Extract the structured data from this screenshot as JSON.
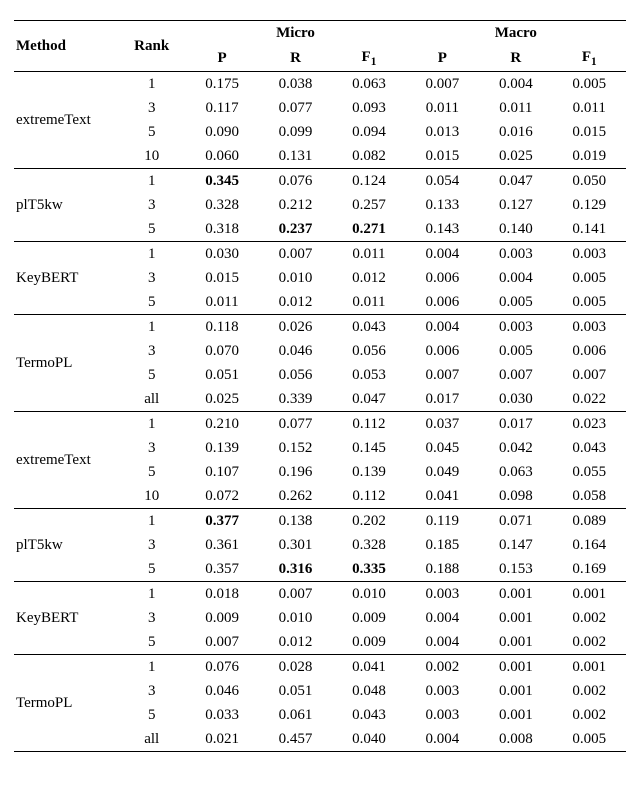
{
  "headers": {
    "method": "Method",
    "rank": "Rank",
    "micro": "Micro",
    "macro": "Macro",
    "P": "P",
    "R": "R",
    "F1_html": "F<sub>1</sub>"
  },
  "chart_data": {
    "type": "table",
    "title": "",
    "column_groups": [
      "Micro",
      "Macro"
    ],
    "columns": [
      "Method",
      "Rank",
      "Micro.P",
      "Micro.R",
      "Micro.F1",
      "Macro.P",
      "Macro.R",
      "Macro.F1"
    ],
    "bold_cells": [
      {
        "group_index": 1,
        "row_index": 0,
        "col": "micro_P"
      },
      {
        "group_index": 1,
        "row_index": 2,
        "col": "micro_R"
      },
      {
        "group_index": 1,
        "row_index": 2,
        "col": "micro_F1"
      },
      {
        "group_index": 5,
        "row_index": 0,
        "col": "micro_P"
      },
      {
        "group_index": 5,
        "row_index": 2,
        "col": "micro_R"
      },
      {
        "group_index": 5,
        "row_index": 2,
        "col": "micro_F1"
      }
    ],
    "groups": [
      {
        "method": "extremeText",
        "rows": [
          {
            "rank": "1",
            "micro_P": "0.175",
            "micro_R": "0.038",
            "micro_F1": "0.063",
            "macro_P": "0.007",
            "macro_R": "0.004",
            "macro_F1": "0.005"
          },
          {
            "rank": "3",
            "micro_P": "0.117",
            "micro_R": "0.077",
            "micro_F1": "0.093",
            "macro_P": "0.011",
            "macro_R": "0.011",
            "macro_F1": "0.011"
          },
          {
            "rank": "5",
            "micro_P": "0.090",
            "micro_R": "0.099",
            "micro_F1": "0.094",
            "macro_P": "0.013",
            "macro_R": "0.016",
            "macro_F1": "0.015"
          },
          {
            "rank": "10",
            "micro_P": "0.060",
            "micro_R": "0.131",
            "micro_F1": "0.082",
            "macro_P": "0.015",
            "macro_R": "0.025",
            "macro_F1": "0.019"
          }
        ]
      },
      {
        "method": "plT5kw",
        "rows": [
          {
            "rank": "1",
            "micro_P": "0.345",
            "micro_R": "0.076",
            "micro_F1": "0.124",
            "macro_P": "0.054",
            "macro_R": "0.047",
            "macro_F1": "0.050"
          },
          {
            "rank": "3",
            "micro_P": "0.328",
            "micro_R": "0.212",
            "micro_F1": "0.257",
            "macro_P": "0.133",
            "macro_R": "0.127",
            "macro_F1": "0.129"
          },
          {
            "rank": "5",
            "micro_P": "0.318",
            "micro_R": "0.237",
            "micro_F1": "0.271",
            "macro_P": "0.143",
            "macro_R": "0.140",
            "macro_F1": "0.141"
          }
        ]
      },
      {
        "method": "KeyBERT",
        "rows": [
          {
            "rank": "1",
            "micro_P": "0.030",
            "micro_R": "0.007",
            "micro_F1": "0.011",
            "macro_P": "0.004",
            "macro_R": "0.003",
            "macro_F1": "0.003"
          },
          {
            "rank": "3",
            "micro_P": "0.015",
            "micro_R": "0.010",
            "micro_F1": "0.012",
            "macro_P": "0.006",
            "macro_R": "0.004",
            "macro_F1": "0.005"
          },
          {
            "rank": "5",
            "micro_P": "0.011",
            "micro_R": "0.012",
            "micro_F1": "0.011",
            "macro_P": "0.006",
            "macro_R": "0.005",
            "macro_F1": "0.005"
          }
        ]
      },
      {
        "method": "TermoPL",
        "rows": [
          {
            "rank": "1",
            "micro_P": "0.118",
            "micro_R": "0.026",
            "micro_F1": "0.043",
            "macro_P": "0.004",
            "macro_R": "0.003",
            "macro_F1": "0.003"
          },
          {
            "rank": "3",
            "micro_P": "0.070",
            "micro_R": "0.046",
            "micro_F1": "0.056",
            "macro_P": "0.006",
            "macro_R": "0.005",
            "macro_F1": "0.006"
          },
          {
            "rank": "5",
            "micro_P": "0.051",
            "micro_R": "0.056",
            "micro_F1": "0.053",
            "macro_P": "0.007",
            "macro_R": "0.007",
            "macro_F1": "0.007"
          },
          {
            "rank": "all",
            "micro_P": "0.025",
            "micro_R": "0.339",
            "micro_F1": "0.047",
            "macro_P": "0.017",
            "macro_R": "0.030",
            "macro_F1": "0.022"
          }
        ]
      },
      {
        "method": "extremeText",
        "rows": [
          {
            "rank": "1",
            "micro_P": "0.210",
            "micro_R": "0.077",
            "micro_F1": "0.112",
            "macro_P": "0.037",
            "macro_R": "0.017",
            "macro_F1": "0.023"
          },
          {
            "rank": "3",
            "micro_P": "0.139",
            "micro_R": "0.152",
            "micro_F1": "0.145",
            "macro_P": "0.045",
            "macro_R": "0.042",
            "macro_F1": "0.043"
          },
          {
            "rank": "5",
            "micro_P": "0.107",
            "micro_R": "0.196",
            "micro_F1": "0.139",
            "macro_P": "0.049",
            "macro_R": "0.063",
            "macro_F1": "0.055"
          },
          {
            "rank": "10",
            "micro_P": "0.072",
            "micro_R": "0.262",
            "micro_F1": "0.112",
            "macro_P": "0.041",
            "macro_R": "0.098",
            "macro_F1": "0.058"
          }
        ]
      },
      {
        "method": "plT5kw",
        "rows": [
          {
            "rank": "1",
            "micro_P": "0.377",
            "micro_R": "0.138",
            "micro_F1": "0.202",
            "macro_P": "0.119",
            "macro_R": "0.071",
            "macro_F1": "0.089"
          },
          {
            "rank": "3",
            "micro_P": "0.361",
            "micro_R": "0.301",
            "micro_F1": "0.328",
            "macro_P": "0.185",
            "macro_R": "0.147",
            "macro_F1": "0.164"
          },
          {
            "rank": "5",
            "micro_P": "0.357",
            "micro_R": "0.316",
            "micro_F1": "0.335",
            "macro_P": "0.188",
            "macro_R": "0.153",
            "macro_F1": "0.169"
          }
        ]
      },
      {
        "method": "KeyBERT",
        "rows": [
          {
            "rank": "1",
            "micro_P": "0.018",
            "micro_R": "0.007",
            "micro_F1": "0.010",
            "macro_P": "0.003",
            "macro_R": "0.001",
            "macro_F1": "0.001"
          },
          {
            "rank": "3",
            "micro_P": "0.009",
            "micro_R": "0.010",
            "micro_F1": "0.009",
            "macro_P": "0.004",
            "macro_R": "0.001",
            "macro_F1": "0.002"
          },
          {
            "rank": "5",
            "micro_P": "0.007",
            "micro_R": "0.012",
            "micro_F1": "0.009",
            "macro_P": "0.004",
            "macro_R": "0.001",
            "macro_F1": "0.002"
          }
        ]
      },
      {
        "method": "TermoPL",
        "rows": [
          {
            "rank": "1",
            "micro_P": "0.076",
            "micro_R": "0.028",
            "micro_F1": "0.041",
            "macro_P": "0.002",
            "macro_R": "0.001",
            "macro_F1": "0.001"
          },
          {
            "rank": "3",
            "micro_P": "0.046",
            "micro_R": "0.051",
            "micro_F1": "0.048",
            "macro_P": "0.003",
            "macro_R": "0.001",
            "macro_F1": "0.002"
          },
          {
            "rank": "5",
            "micro_P": "0.033",
            "micro_R": "0.061",
            "micro_F1": "0.043",
            "macro_P": "0.003",
            "macro_R": "0.001",
            "macro_F1": "0.002"
          },
          {
            "rank": "all",
            "micro_P": "0.021",
            "micro_R": "0.457",
            "micro_F1": "0.040",
            "macro_P": "0.004",
            "macro_R": "0.008",
            "macro_F1": "0.005"
          }
        ]
      }
    ]
  }
}
